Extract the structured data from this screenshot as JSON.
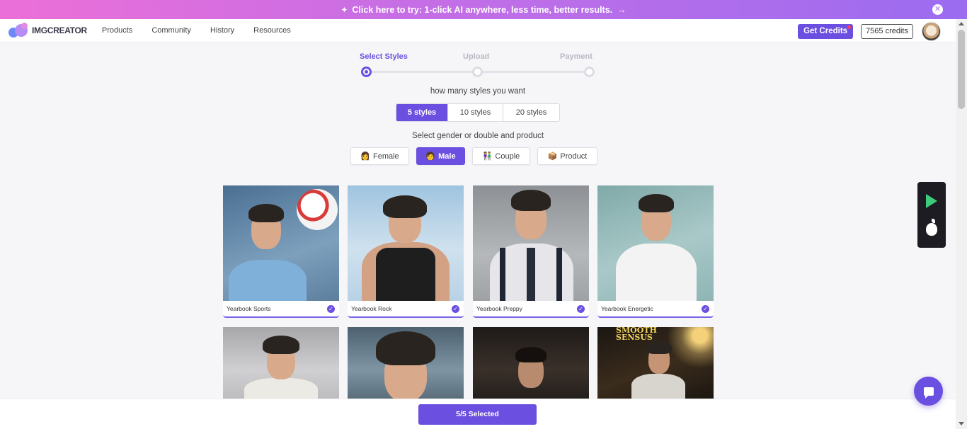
{
  "banner": {
    "text": "Click here to try: 1-click AI anywhere, less time, better results.",
    "arrow": "→",
    "close": "✕"
  },
  "header": {
    "logo": "IMGCREATOR",
    "nav": [
      "Products",
      "Community",
      "History",
      "Resources"
    ],
    "get_credits": "Get Credits",
    "credits": "7565 credits"
  },
  "stepper": {
    "steps": [
      "Select Styles",
      "Upload",
      "Payment"
    ],
    "active": 0
  },
  "styles_question": "how many styles you want",
  "style_options": [
    "5 styles",
    "10 styles",
    "20 styles"
  ],
  "style_selected": "5 styles",
  "gender_question": "Select gender or double and product",
  "gender_options": [
    {
      "emoji": "👩",
      "label": "Female"
    },
    {
      "emoji": "🧑",
      "label": "Male"
    },
    {
      "emoji": "👫",
      "label": "Couple"
    },
    {
      "emoji": "📦",
      "label": "Product"
    }
  ],
  "gender_selected": "Male",
  "cards": [
    {
      "label": "Yearbook Sports",
      "selected": true
    },
    {
      "label": "Yearbook Rock",
      "selected": true
    },
    {
      "label": "Yearbook Preppy",
      "selected": true
    },
    {
      "label": "Yearbook Energetic",
      "selected": true
    }
  ],
  "magazine_text": {
    "line1": "SMOOTH",
    "line2": "SENSUS"
  },
  "selection_status": "5/5 Selected",
  "icons": [
    "sparkle-icon",
    "close-icon",
    "google-play-icon",
    "apple-icon",
    "chat-icon",
    "check-icon"
  ],
  "colors": {
    "accent": "#6b4fe0",
    "banner_start": "#ec6fd8",
    "banner_end": "#9b6cf0"
  }
}
